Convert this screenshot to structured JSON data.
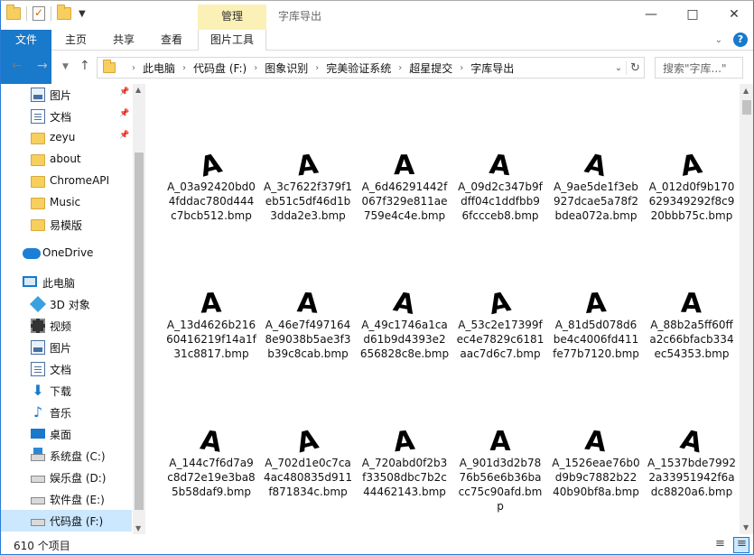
{
  "title": "字库导出",
  "quick_access_toolbar": [
    "folder-icon",
    "properties-icon",
    "new-folder-icon"
  ],
  "contextual_tab": "管理",
  "window_controls": [
    "—",
    "□",
    "✕"
  ],
  "ribbon": {
    "tabs": [
      "文件",
      "主页",
      "共享",
      "查看",
      "图片工具"
    ]
  },
  "nav": {
    "back": "←",
    "forward": "→",
    "up": "↑",
    "breadcrumbs": [
      "此电脑",
      "代码盘 (F:)",
      "图象识别",
      "完美验证系统",
      "超星提交",
      "字库导出"
    ],
    "search_placeholder": "搜索\"字库...\""
  },
  "sidebar": {
    "items": [
      {
        "label": "图片",
        "icon": "pictures-icon",
        "pinned": true
      },
      {
        "label": "文档",
        "icon": "documents-icon",
        "pinned": true
      },
      {
        "label": "zeyu",
        "icon": "folder-icon",
        "pinned": true
      },
      {
        "label": "about",
        "icon": "folder-icon",
        "pinned": false
      },
      {
        "label": "ChromeAPI",
        "icon": "folder-icon",
        "pinned": false
      },
      {
        "label": "Music",
        "icon": "folder-icon",
        "pinned": false
      },
      {
        "label": "易模版",
        "icon": "folder-icon",
        "pinned": false
      },
      {
        "label": "OneDrive",
        "icon": "onedrive-icon",
        "pinned": false
      },
      {
        "label": "此电脑",
        "icon": "this-pc-icon",
        "pinned": false
      },
      {
        "label": "3D 对象",
        "icon": "3d-objects-icon",
        "pinned": false
      },
      {
        "label": "视频",
        "icon": "videos-icon",
        "pinned": false
      },
      {
        "label": "图片",
        "icon": "pictures-icon",
        "pinned": false
      },
      {
        "label": "文档",
        "icon": "documents-icon",
        "pinned": false
      },
      {
        "label": "下载",
        "icon": "downloads-icon",
        "pinned": false
      },
      {
        "label": "音乐",
        "icon": "music-icon",
        "pinned": false
      },
      {
        "label": "桌面",
        "icon": "desktop-icon",
        "pinned": false
      },
      {
        "label": "系统盘 (C:)",
        "icon": "system-drive-icon",
        "pinned": false
      },
      {
        "label": "娱乐盘 (D:)",
        "icon": "drive-icon",
        "pinned": false
      },
      {
        "label": "软件盘 (E:)",
        "icon": "drive-icon",
        "pinned": false
      },
      {
        "label": "代码盘 (F:)",
        "icon": "drive-icon",
        "pinned": false,
        "selected": true
      }
    ]
  },
  "files": [
    {
      "line1": "A_03a92420bd0",
      "line2": "4fddac780d444",
      "line3": "c7bcb512.bmp",
      "glyph": "A"
    },
    {
      "line1": "A_3c7622f379f1",
      "line2": "eb51c5df46d1b",
      "line3": "3dda2e3.bmp",
      "glyph": "A"
    },
    {
      "line1": "A_6d46291442f",
      "line2": "067f329e811ae",
      "line3": "759e4c4e.bmp",
      "glyph": "A"
    },
    {
      "line1": "A_09d2c347b9f",
      "line2": "dff04c1ddfbb9",
      "line3": "6fccceb8.bmp",
      "glyph": "A"
    },
    {
      "line1": "A_9ae5de1f3eb",
      "line2": "927dcae5a78f2",
      "line3": "bdea072a.bmp",
      "glyph": "A"
    },
    {
      "line1": "A_012d0f9b170",
      "line2": "629349292f8c9",
      "line3": "20bbb75c.bmp",
      "glyph": "A"
    },
    {
      "line1": "A_13d4626b216",
      "line2": "60416219f14a1f",
      "line3": "31c8817.bmp",
      "glyph": "A"
    },
    {
      "line1": "A_46e7f497164",
      "line2": "8e9038b5ae3f3",
      "line3": "b39c8cab.bmp",
      "glyph": "A"
    },
    {
      "line1": "A_49c1746a1ca",
      "line2": "d61b9d4393e2",
      "line3": "656828c8e.bmp",
      "glyph": "A"
    },
    {
      "line1": "A_53c2e17399f",
      "line2": "ec4e7829c6181",
      "line3": "aac7d6c7.bmp",
      "glyph": "A"
    },
    {
      "line1": "A_81d5d078d6",
      "line2": "be4c4006fd411",
      "line3": "fe77b7120.bmp",
      "glyph": "A"
    },
    {
      "line1": "A_88b2a5ff60ff",
      "line2": "a2c66bfacb334",
      "line3": "ec54353.bmp",
      "glyph": "A"
    },
    {
      "line1": "A_144c7f6d7a9",
      "line2": "c8d72e19e3ba8",
      "line3": "5b58daf9.bmp",
      "glyph": "A"
    },
    {
      "line1": "A_702d1e0c7ca",
      "line2": "4ac480835d911",
      "line3": "f871834c.bmp",
      "glyph": "A"
    },
    {
      "line1": "A_720abd0f2b3",
      "line2": "f33508dbc7b2c",
      "line3": "44462143.bmp",
      "glyph": "A"
    },
    {
      "line1": "A_901d3d2b78",
      "line2": "76b56e6b36ba",
      "line3": "cc75c90afd.bm",
      "line4": "p",
      "glyph": "A"
    },
    {
      "line1": "A_1526eae76b0",
      "line2": "d9b9c7882b22",
      "line3": "40b90bf8a.bmp",
      "glyph": "A"
    },
    {
      "line1": "A_1537bde7992",
      "line2": "2a33951942f6a",
      "line3": "dc8820a6.bmp",
      "glyph": "A"
    }
  ],
  "status": {
    "item_count": "610 个项目"
  },
  "colors": {
    "accent": "#1979ca",
    "contextual_tab": "#fbf1b6",
    "selection": "#cce8ff"
  }
}
